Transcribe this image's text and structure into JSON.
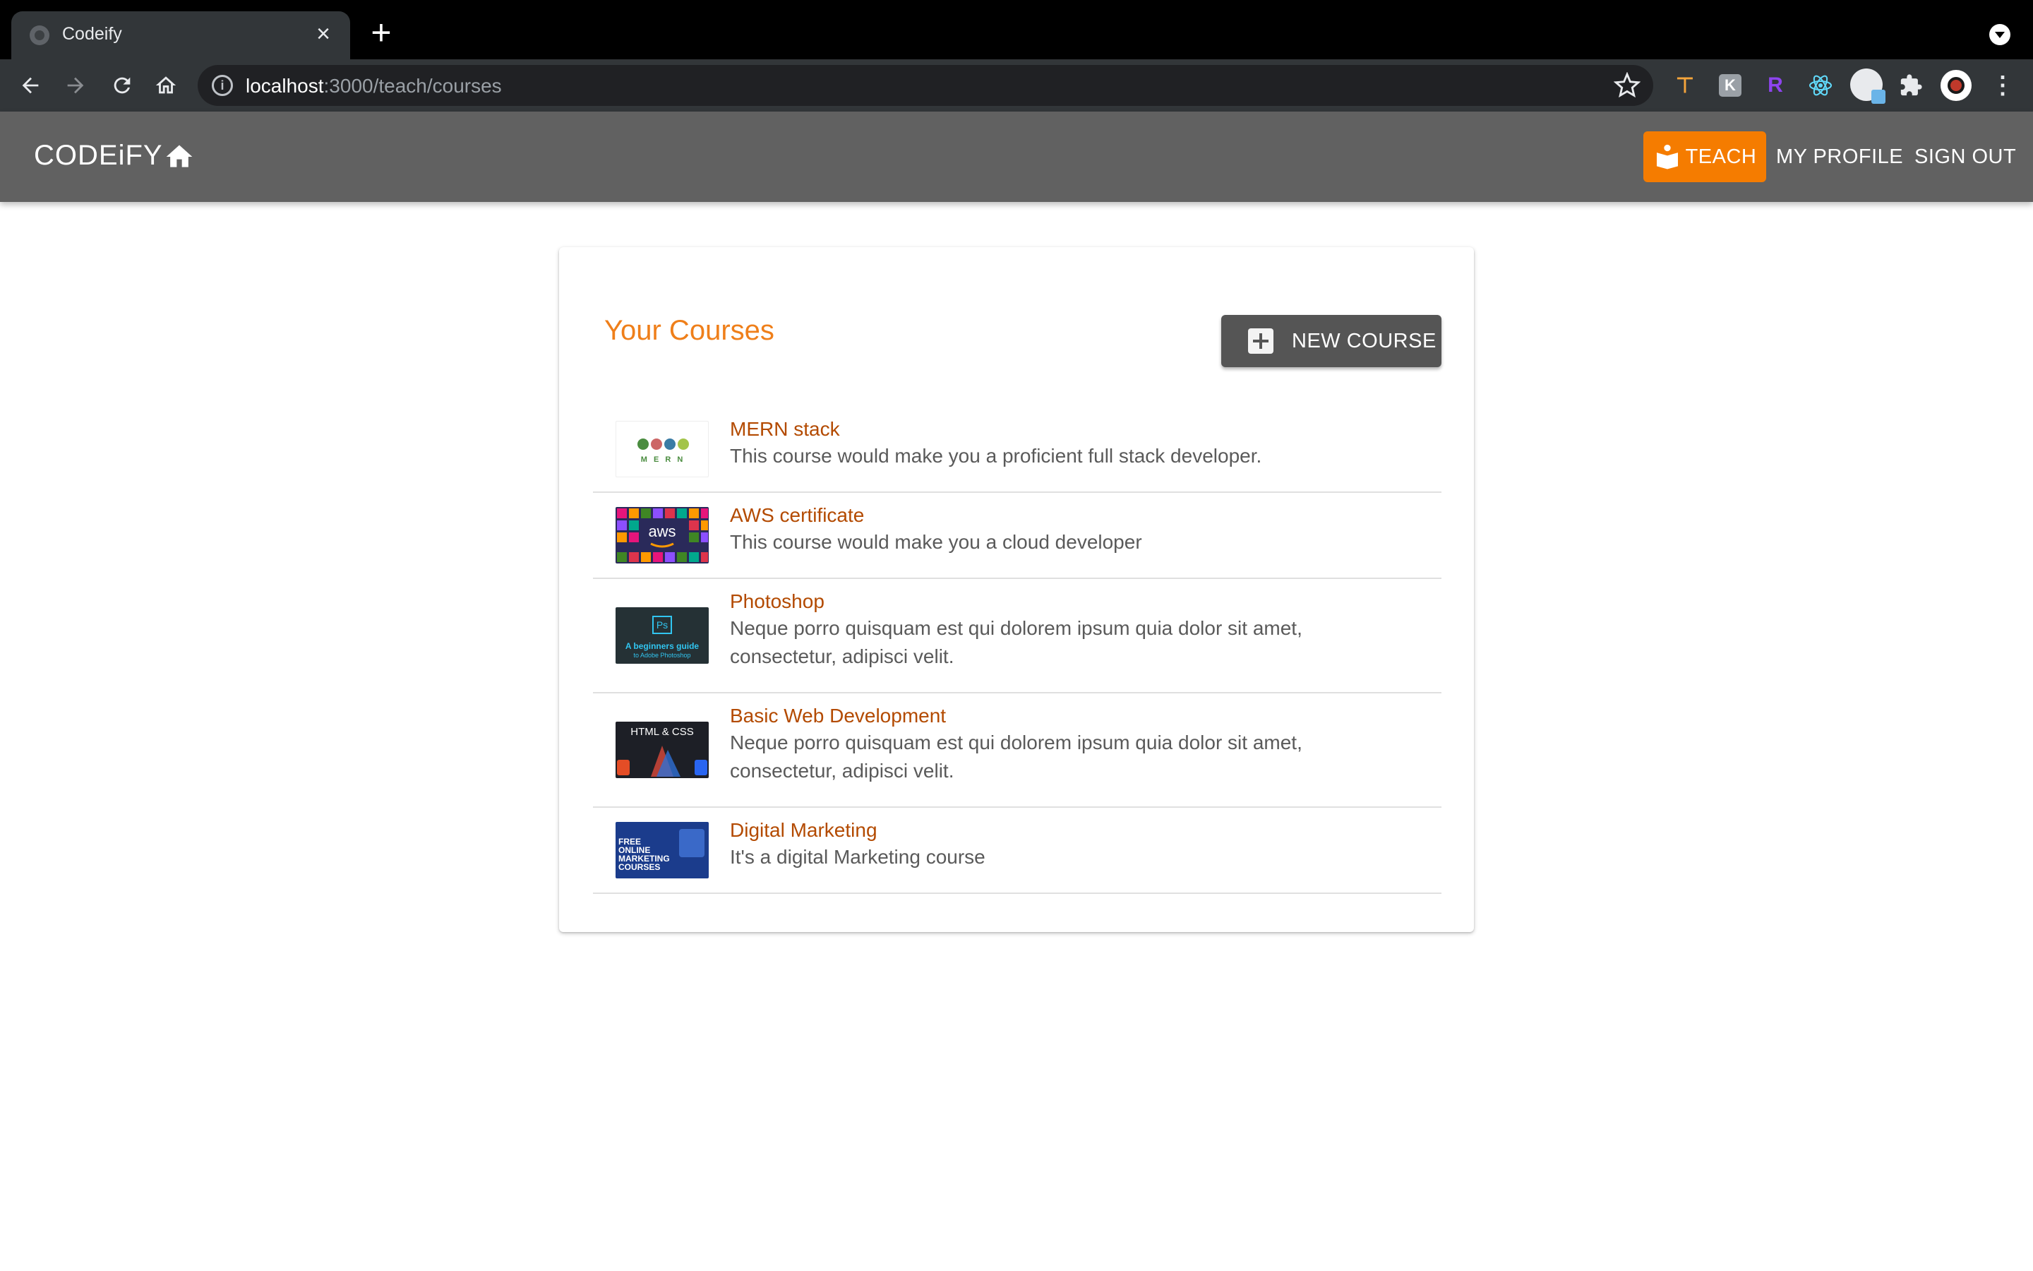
{
  "browser": {
    "tab_title": "Codeify",
    "url_host": "localhost",
    "url_path": ":3000/teach/courses"
  },
  "appbar": {
    "brand": "CODEiFY",
    "teach_label": "TEACH",
    "profile_label": "MY PROFILE",
    "signout_label": "SIGN OUT",
    "accent_color": "#f57c00"
  },
  "card": {
    "title": "Your Courses",
    "new_course_label": "NEW COURSE"
  },
  "courses": [
    {
      "name": "MERN stack",
      "description": "This course would make you a proficient full stack developer.",
      "thumb_text": "M E R N"
    },
    {
      "name": "AWS certificate",
      "description": "This course would make you a cloud developer",
      "thumb_text": "aws"
    },
    {
      "name": "Photoshop",
      "description": "Neque porro quisquam est qui dolorem ipsum quia dolor sit amet, consectetur, adipisci velit.",
      "thumb_text": "Ps",
      "thumb_caption": "A beginners guide",
      "thumb_sub": "to Adobe Photoshop"
    },
    {
      "name": "Basic Web Development",
      "description": "Neque porro quisquam est qui dolorem ipsum quia dolor sit amet, consectetur, adipisci velit.",
      "thumb_text": "HTML & CSS"
    },
    {
      "name": "Digital Marketing",
      "description": "It's a digital Marketing course",
      "thumb_text": "FREE ONLINE MARKETING COURSES"
    }
  ]
}
